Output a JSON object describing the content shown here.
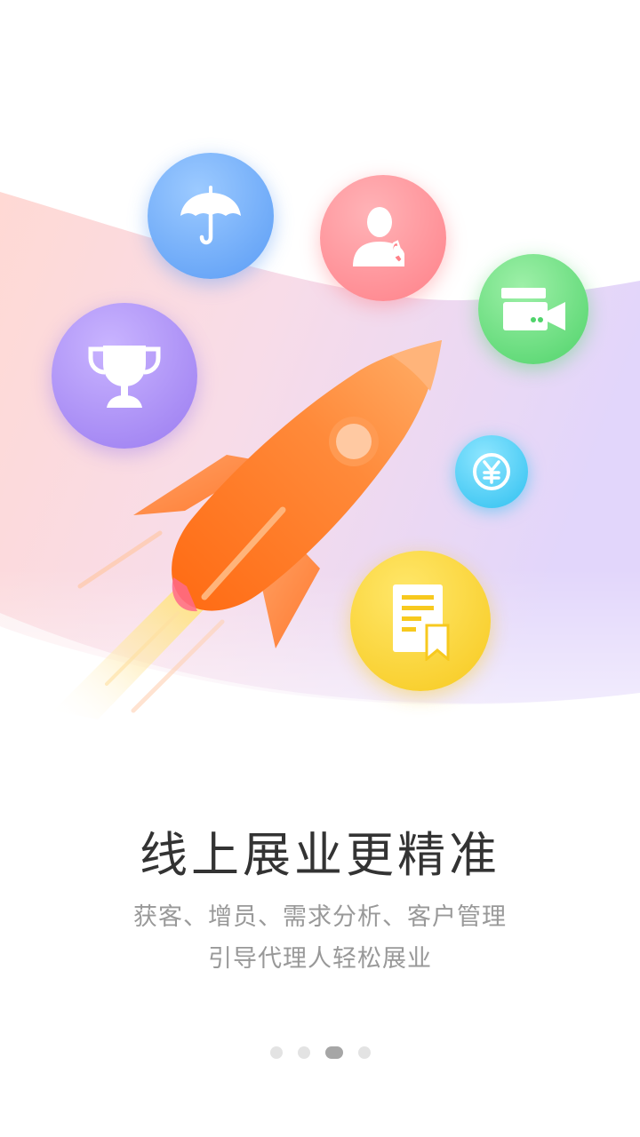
{
  "hero": {
    "icons": [
      "umbrella-icon",
      "contact-phone-icon",
      "video-card-icon",
      "trophy-icon",
      "yen-coin-icon",
      "document-bookmark-icon",
      "rocket-illustration"
    ],
    "colors": {
      "blue": "#5a9cf5",
      "pink": "#ff8088",
      "green": "#4fd36a",
      "purple": "#9a7bf0",
      "cyan": "#2fc0f0",
      "yellow": "#f7c91e",
      "rocket": "#ff7a22"
    }
  },
  "content": {
    "title": "线上展业更精准",
    "subtitle_line1": "获客、增员、需求分析、客户管理",
    "subtitle_line2": "引导代理人轻松展业"
  },
  "pager": {
    "total": 4,
    "current": 3
  }
}
